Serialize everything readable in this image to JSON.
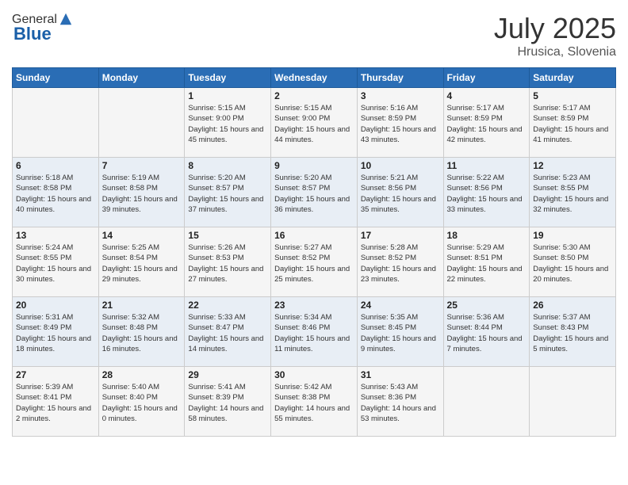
{
  "header": {
    "logo_general": "General",
    "logo_blue": "Blue",
    "month": "July 2025",
    "location": "Hrusica, Slovenia"
  },
  "days_of_week": [
    "Sunday",
    "Monday",
    "Tuesday",
    "Wednesday",
    "Thursday",
    "Friday",
    "Saturday"
  ],
  "weeks": [
    [
      {
        "num": "",
        "info": ""
      },
      {
        "num": "",
        "info": ""
      },
      {
        "num": "1",
        "info": "Sunrise: 5:15 AM\nSunset: 9:00 PM\nDaylight: 15 hours and 45 minutes."
      },
      {
        "num": "2",
        "info": "Sunrise: 5:15 AM\nSunset: 9:00 PM\nDaylight: 15 hours and 44 minutes."
      },
      {
        "num": "3",
        "info": "Sunrise: 5:16 AM\nSunset: 8:59 PM\nDaylight: 15 hours and 43 minutes."
      },
      {
        "num": "4",
        "info": "Sunrise: 5:17 AM\nSunset: 8:59 PM\nDaylight: 15 hours and 42 minutes."
      },
      {
        "num": "5",
        "info": "Sunrise: 5:17 AM\nSunset: 8:59 PM\nDaylight: 15 hours and 41 minutes."
      }
    ],
    [
      {
        "num": "6",
        "info": "Sunrise: 5:18 AM\nSunset: 8:58 PM\nDaylight: 15 hours and 40 minutes."
      },
      {
        "num": "7",
        "info": "Sunrise: 5:19 AM\nSunset: 8:58 PM\nDaylight: 15 hours and 39 minutes."
      },
      {
        "num": "8",
        "info": "Sunrise: 5:20 AM\nSunset: 8:57 PM\nDaylight: 15 hours and 37 minutes."
      },
      {
        "num": "9",
        "info": "Sunrise: 5:20 AM\nSunset: 8:57 PM\nDaylight: 15 hours and 36 minutes."
      },
      {
        "num": "10",
        "info": "Sunrise: 5:21 AM\nSunset: 8:56 PM\nDaylight: 15 hours and 35 minutes."
      },
      {
        "num": "11",
        "info": "Sunrise: 5:22 AM\nSunset: 8:56 PM\nDaylight: 15 hours and 33 minutes."
      },
      {
        "num": "12",
        "info": "Sunrise: 5:23 AM\nSunset: 8:55 PM\nDaylight: 15 hours and 32 minutes."
      }
    ],
    [
      {
        "num": "13",
        "info": "Sunrise: 5:24 AM\nSunset: 8:55 PM\nDaylight: 15 hours and 30 minutes."
      },
      {
        "num": "14",
        "info": "Sunrise: 5:25 AM\nSunset: 8:54 PM\nDaylight: 15 hours and 29 minutes."
      },
      {
        "num": "15",
        "info": "Sunrise: 5:26 AM\nSunset: 8:53 PM\nDaylight: 15 hours and 27 minutes."
      },
      {
        "num": "16",
        "info": "Sunrise: 5:27 AM\nSunset: 8:52 PM\nDaylight: 15 hours and 25 minutes."
      },
      {
        "num": "17",
        "info": "Sunrise: 5:28 AM\nSunset: 8:52 PM\nDaylight: 15 hours and 23 minutes."
      },
      {
        "num": "18",
        "info": "Sunrise: 5:29 AM\nSunset: 8:51 PM\nDaylight: 15 hours and 22 minutes."
      },
      {
        "num": "19",
        "info": "Sunrise: 5:30 AM\nSunset: 8:50 PM\nDaylight: 15 hours and 20 minutes."
      }
    ],
    [
      {
        "num": "20",
        "info": "Sunrise: 5:31 AM\nSunset: 8:49 PM\nDaylight: 15 hours and 18 minutes."
      },
      {
        "num": "21",
        "info": "Sunrise: 5:32 AM\nSunset: 8:48 PM\nDaylight: 15 hours and 16 minutes."
      },
      {
        "num": "22",
        "info": "Sunrise: 5:33 AM\nSunset: 8:47 PM\nDaylight: 15 hours and 14 minutes."
      },
      {
        "num": "23",
        "info": "Sunrise: 5:34 AM\nSunset: 8:46 PM\nDaylight: 15 hours and 11 minutes."
      },
      {
        "num": "24",
        "info": "Sunrise: 5:35 AM\nSunset: 8:45 PM\nDaylight: 15 hours and 9 minutes."
      },
      {
        "num": "25",
        "info": "Sunrise: 5:36 AM\nSunset: 8:44 PM\nDaylight: 15 hours and 7 minutes."
      },
      {
        "num": "26",
        "info": "Sunrise: 5:37 AM\nSunset: 8:43 PM\nDaylight: 15 hours and 5 minutes."
      }
    ],
    [
      {
        "num": "27",
        "info": "Sunrise: 5:39 AM\nSunset: 8:41 PM\nDaylight: 15 hours and 2 minutes."
      },
      {
        "num": "28",
        "info": "Sunrise: 5:40 AM\nSunset: 8:40 PM\nDaylight: 15 hours and 0 minutes."
      },
      {
        "num": "29",
        "info": "Sunrise: 5:41 AM\nSunset: 8:39 PM\nDaylight: 14 hours and 58 minutes."
      },
      {
        "num": "30",
        "info": "Sunrise: 5:42 AM\nSunset: 8:38 PM\nDaylight: 14 hours and 55 minutes."
      },
      {
        "num": "31",
        "info": "Sunrise: 5:43 AM\nSunset: 8:36 PM\nDaylight: 14 hours and 53 minutes."
      },
      {
        "num": "",
        "info": ""
      },
      {
        "num": "",
        "info": ""
      }
    ]
  ]
}
